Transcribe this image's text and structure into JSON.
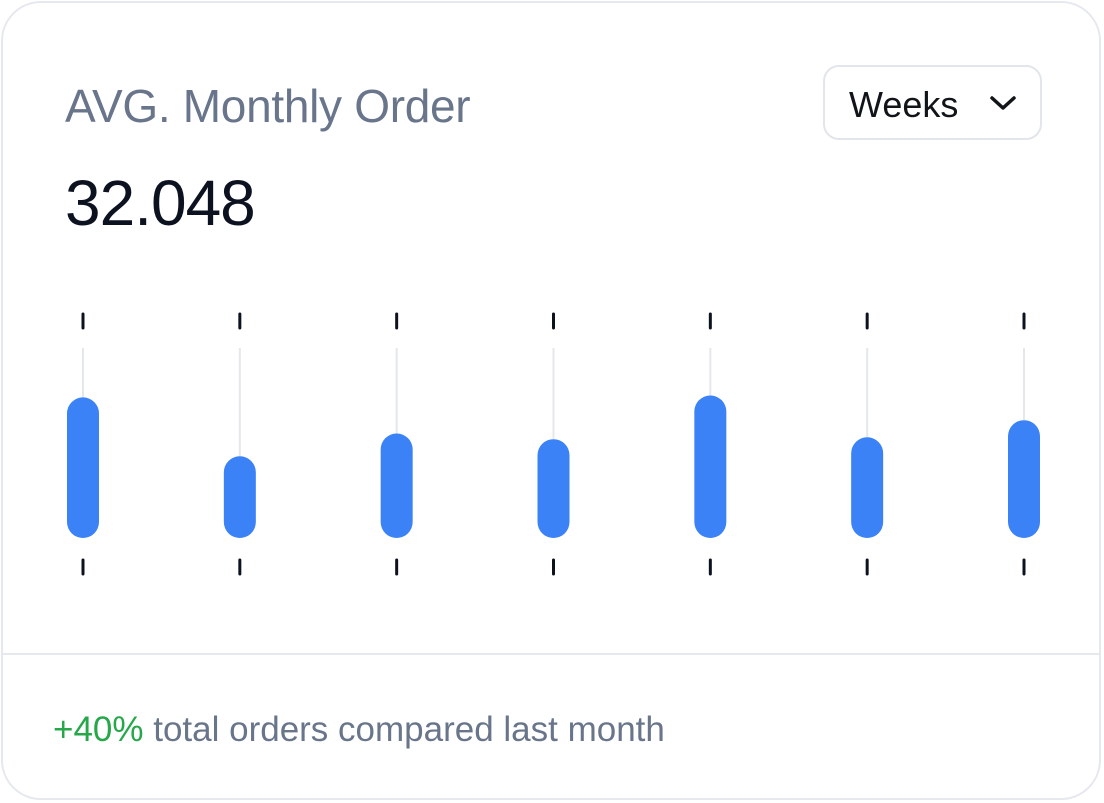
{
  "card": {
    "title": "AVG. Monthly Order",
    "value": "32.048"
  },
  "period_select": {
    "selected": "Weeks",
    "icon": "chevron-down-icon"
  },
  "footer": {
    "change": "+40%",
    "text": " total orders compared last month"
  },
  "colors": {
    "bar": "#3b82f6",
    "track": "#e4e7ec",
    "tick": "#0d1220",
    "positive": "#26a749",
    "muted": "#68758a"
  },
  "chart_data": {
    "type": "bar",
    "categories": [
      "",
      "",
      "",
      "",
      "",
      "",
      ""
    ],
    "series": [
      {
        "values": [
          [
            0,
            0.74
          ],
          [
            0,
            0.43
          ],
          [
            0,
            0.55
          ],
          [
            0,
            0.52
          ],
          [
            0,
            0.75
          ],
          [
            0,
            0.53
          ],
          [
            0,
            0.62
          ]
        ]
      }
    ],
    "ylim": [
      0,
      1
    ],
    "grid": true,
    "legend": null
  }
}
